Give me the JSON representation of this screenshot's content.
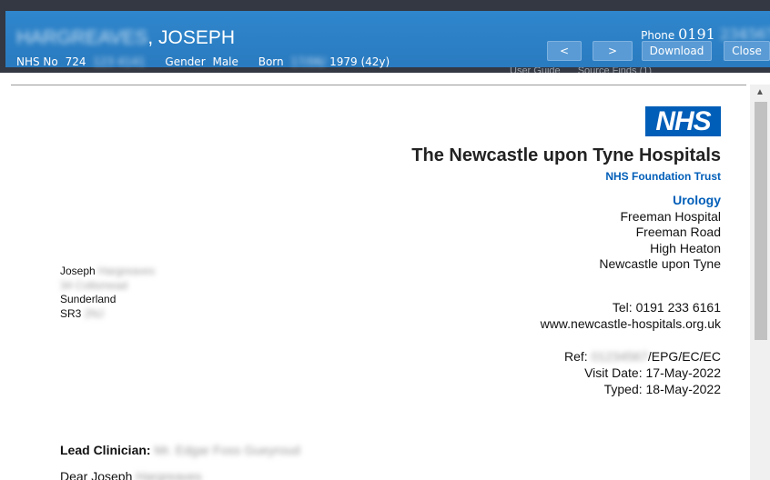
{
  "header": {
    "surname_redacted": "HARGREAVES",
    "forename": ", JOSEPH",
    "nhs_label": "NHS No",
    "nhs_number_visible": "724",
    "nhs_number_redacted": "123 4141",
    "gender_label": "Gender",
    "gender": "Male",
    "born_label": "Born",
    "born_redacted": "17/06/",
    "born_year_age": "1979 (42y)",
    "phone_label": "Phone",
    "phone_visible": "0191",
    "phone_redacted": " 234567",
    "background_peek": [
      "User Guide",
      "Source Finds (1)"
    ]
  },
  "toolbar": {
    "prev_label": "<",
    "next_label": ">",
    "download_label": "Download",
    "close_label": "Close"
  },
  "letter": {
    "logo_text": "NHS",
    "trust_name": "The Newcastle upon Tyne Hospitals",
    "trust_sub": "NHS Foundation Trust",
    "department": "Urology",
    "address": [
      "Freeman Hospital",
      "Freeman Road",
      "High Heaton",
      "Newcastle upon Tyne"
    ],
    "tel": "Tel: 0191 233 6161",
    "website": "www.newcastle-hospitals.org.uk",
    "ref_label": "Ref:",
    "ref_redacted": "01234567",
    "ref_suffix": "/EPG/EC/EC",
    "visit_date": "Visit Date: 17-May-2022",
    "typed_date": "Typed: 18-May-2022",
    "recipient": {
      "first_name": "Joseph",
      "surname_redacted": "Hargreaves",
      "street_redacted": "34 Coltsmead",
      "town": "Sunderland",
      "postcode_visible": "SR3",
      "postcode_redacted": "2NJ"
    },
    "lead_clinician_label": "Lead Clinician:",
    "lead_clinician_redacted": "Mr. Edgar Foss Gueyroud",
    "salutation": "Dear Joseph",
    "salutation_redacted": "Hargreaves"
  },
  "colors": {
    "header_blue": "#2a7bc0",
    "nhs_blue": "#005eb8",
    "button_blue": "#5a9bd5"
  },
  "icons": {
    "scroll_up": "triangle-up-icon"
  }
}
